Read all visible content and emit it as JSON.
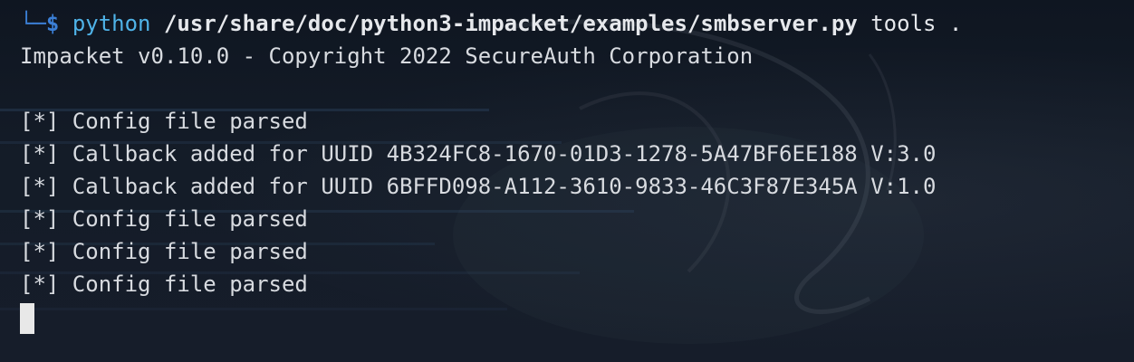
{
  "terminal": {
    "prompt": {
      "branch_glyph": "└─",
      "sign": "$",
      "command": "python",
      "script_path": "/usr/share/doc/python3-impacket/examples/smbserver.py",
      "args": "tools ."
    },
    "output": [
      "Impacket v0.10.0 - Copyright 2022 SecureAuth Corporation",
      "",
      "[*] Config file parsed",
      "[*] Callback added for UUID 4B324FC8-1670-01D3-1278-5A47BF6EE188 V:3.0",
      "[*] Callback added for UUID 6BFFD098-A112-3610-9833-46C3F87E345A V:1.0",
      "[*] Config file parsed",
      "[*] Config file parsed",
      "[*] Config file parsed"
    ],
    "colors": {
      "background": "#121a26",
      "prompt_blue": "#3b7fd6",
      "command_cyan": "#4fb3e8",
      "text": "#d8dbe0"
    }
  }
}
